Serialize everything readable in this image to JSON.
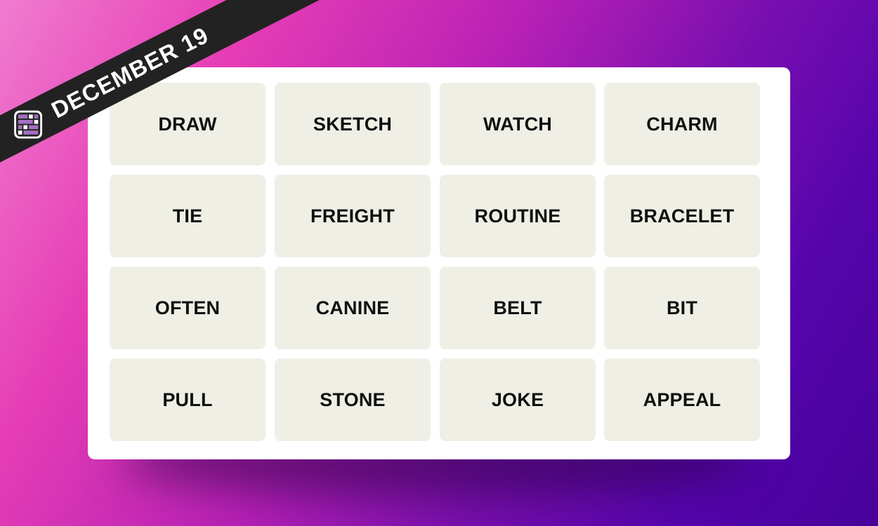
{
  "banner": {
    "date": "DECEMBER 19",
    "icon": "connections-grid-icon"
  },
  "colors": {
    "tile": "#efefe6",
    "icon_purple": "#a36fc2",
    "banner": "#222222"
  },
  "grid": {
    "rows": [
      [
        "DRAW",
        "SKETCH",
        "WATCH",
        "CHARM"
      ],
      [
        "TIE",
        "FREIGHT",
        "ROUTINE",
        "BRACELET"
      ],
      [
        "OFTEN",
        "CANINE",
        "BELT",
        "BIT"
      ],
      [
        "PULL",
        "STONE",
        "JOKE",
        "APPEAL"
      ]
    ]
  }
}
